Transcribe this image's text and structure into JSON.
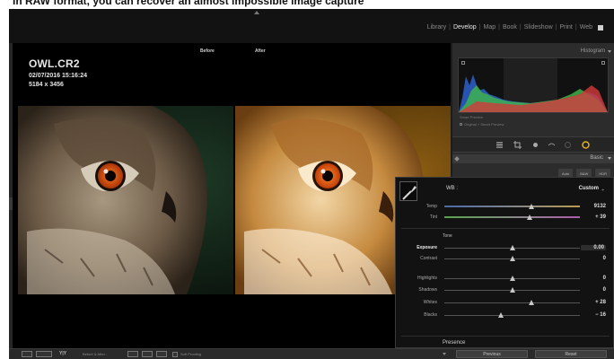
{
  "caption": "In RAW format, you can recover an almost impossible image capture",
  "modules": [
    "Library",
    "Develop",
    "Map",
    "Book",
    "Slideshow",
    "Print",
    "Web"
  ],
  "active_module": "Develop",
  "viewer": {
    "before_label": "Before",
    "after_label": "After",
    "file_name": "OWL.CR2",
    "file_date": "02/07/2016 15:16:24",
    "file_dims": "5184 x 3456"
  },
  "panel": {
    "histogram_title": "Histogram",
    "histogram_info": "Smart Preview",
    "original_photo": "Original + Smart Preview",
    "basic_title": "Basic",
    "treatment": [
      "Auto",
      "B&W",
      "HDR"
    ]
  },
  "basic": {
    "wb_label": "WB :",
    "wb_value": "Custom",
    "wb_caret": "÷",
    "tone_label": "Tone",
    "presence_label": "Presence",
    "sliders": [
      {
        "label": "Temp",
        "value": "9132",
        "level": 0.64
      },
      {
        "label": "Tint",
        "value": "+ 39",
        "level": 0.63
      },
      {
        "label": "Exposure",
        "value": "0.00",
        "level": 0.5
      },
      {
        "label": "Contrast",
        "value": "0",
        "level": 0.5
      },
      {
        "label": "Highlights",
        "value": "0",
        "level": 0.5
      },
      {
        "label": "Shadows",
        "value": "0",
        "level": 0.5
      },
      {
        "label": "Whites",
        "value": "+ 28",
        "level": 0.64
      },
      {
        "label": "Blacks",
        "value": "− 16",
        "level": 0.42
      }
    ]
  },
  "bottombar": {
    "yy_label": "Y|Y",
    "before_after": "Before & After :",
    "soft_proofing": "Soft Proofing",
    "previous": "Previous",
    "reset": "Reset"
  },
  "colors": {
    "app_bg": "#1c1c1c",
    "panel_bg": "#2c2c2c",
    "overlay_bg": "#121212",
    "accent": "#e8e8e8"
  }
}
